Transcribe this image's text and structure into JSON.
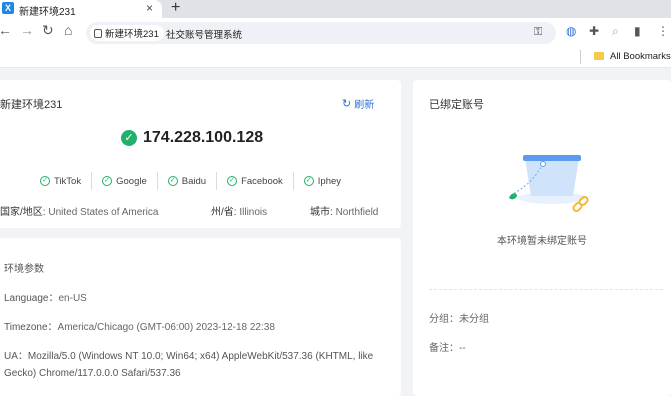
{
  "browser": {
    "tab_title": "新建环境231",
    "tab_favicon": "X",
    "site_chip": "新建环境231",
    "url": "社交账号管理系统",
    "bookmarks_label": "All Bookmarks"
  },
  "env_card": {
    "name": "新建环境231",
    "refresh_label": "刷新",
    "ip": "174.228.100.128",
    "sites": [
      "TikTok",
      "Google",
      "Baidu",
      "Facebook",
      "Iphey"
    ],
    "country_label": "国家/地区:",
    "country_value": "United States of America",
    "state_label": "州/省:",
    "state_value": "Illinois",
    "city_label": "城市:",
    "city_value": "Northfield"
  },
  "params": {
    "title": "环境参数",
    "language_label": "Language：",
    "language_value": "en-US",
    "timezone_label": "Timezone：",
    "timezone_value": "America/Chicago (GMT-06:00) 2023-12-18 22:38",
    "ua_label": "UA：",
    "ua_value": "Mozilla/5.0 (Windows NT 10.0; Win64; x64) AppleWebKit/537.36 (KHTML, like Gecko) Chrome/117.0.0.0 Safari/537.36"
  },
  "accounts": {
    "title": "已绑定账号",
    "empty_text": "本环境暂未绑定账号",
    "group_label": "分组：",
    "group_value": "未分组",
    "note_label": "备注：",
    "note_value": "--"
  },
  "colors": {
    "accent": "#2f6fd6",
    "success": "#22b06b",
    "background": "#f1f3f7"
  }
}
